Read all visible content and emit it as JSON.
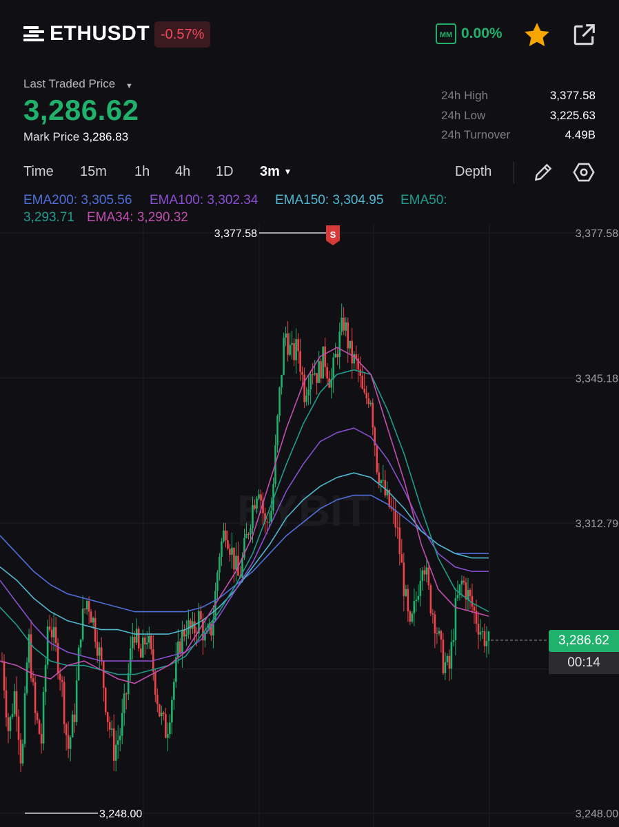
{
  "header": {
    "pair": "ETHUSDT",
    "change": "-0.57%",
    "mm_label": "MM",
    "mm_value": "0.00%"
  },
  "price_block": {
    "last_traded_label": "Last Traded Price",
    "last_price": "3,286.62",
    "mark_label": "Mark Price",
    "mark_price": "3,286.83"
  },
  "stats": [
    {
      "label": "24h High",
      "value": "3,377.58"
    },
    {
      "label": "24h Low",
      "value": "3,225.63"
    },
    {
      "label": "24h Turnover",
      "value": "4.49B"
    }
  ],
  "tabs": {
    "time": "Time",
    "m15": "15m",
    "h1": "1h",
    "h4": "4h",
    "d1": "1D",
    "m3": "3m",
    "depth": "Depth"
  },
  "ema_legend": {
    "ema200": "EMA200: 3,305.56",
    "ema100": "EMA100: 3,302.34",
    "ema150": "EMA150: 3,304.95",
    "ema50_label": "EMA50:",
    "ema50_value": "3,293.71",
    "ema34": "EMA34: 3,290.32"
  },
  "colors": {
    "up": "#20b26c",
    "down": "#ef454a",
    "ema200": "#4f6fd8",
    "ema100": "#8a4fd0",
    "ema150": "#4fb6cf",
    "ema50": "#1f9c8c",
    "ema34": "#c24fb0"
  },
  "chart_data": {
    "type": "candlestick",
    "y_ticks": [
      "3,377.58",
      "3,345.18",
      "3,312.79",
      "3,248.00"
    ],
    "ylim": [
      3248.0,
      3377.58
    ],
    "high_marker": "3,377.58",
    "low_marker": "3,248.00",
    "high_value": 3377.58,
    "low_value": 3248.0,
    "current_price": "3,286.62",
    "current_value": 3286.62,
    "countdown": "00:14",
    "signal_label": "S",
    "watermark": "BYBIT",
    "close_path": [
      3282,
      3266,
      3276,
      3258,
      3288,
      3270,
      3264,
      3292,
      3286,
      3278,
      3262,
      3270,
      3290,
      3296,
      3290,
      3282,
      3270,
      3262,
      3266,
      3276,
      3290,
      3282,
      3288,
      3280,
      3270,
      3266,
      3276,
      3286,
      3290,
      3288,
      3292,
      3286,
      3290,
      3306,
      3312,
      3306,
      3300,
      3308,
      3316,
      3322,
      3312,
      3316,
      3338,
      3356,
      3350,
      3352,
      3342,
      3348,
      3346,
      3350,
      3344,
      3352,
      3358,
      3350,
      3348,
      3340,
      3342,
      3326,
      3320,
      3316,
      3312,
      3300,
      3288,
      3296,
      3306,
      3296,
      3290,
      3282,
      3280,
      3294,
      3300,
      3296,
      3292,
      3288,
      3286
    ],
    "ema_series": {
      "ema34": [
        3282,
        3281,
        3279,
        3278,
        3281,
        3282,
        3280,
        3278,
        3277,
        3279,
        3281,
        3284,
        3290,
        3296,
        3302,
        3310,
        3322,
        3334,
        3344,
        3350,
        3352,
        3350,
        3346,
        3334,
        3322,
        3308,
        3298,
        3294,
        3293,
        3292
      ],
      "ema50": [
        3294,
        3290,
        3285,
        3282,
        3281,
        3281,
        3280,
        3279,
        3279,
        3280,
        3281,
        3283,
        3288,
        3293,
        3299,
        3306,
        3316,
        3326,
        3335,
        3342,
        3346,
        3347,
        3346,
        3338,
        3328,
        3316,
        3305,
        3298,
        3295,
        3293
      ],
      "ema100": [
        3300,
        3295,
        3290,
        3286,
        3284,
        3283,
        3282,
        3282,
        3282,
        3282,
        3283,
        3284,
        3287,
        3292,
        3298,
        3304,
        3312,
        3320,
        3326,
        3331,
        3333,
        3334,
        3332,
        3327,
        3320,
        3312,
        3306,
        3303,
        3302,
        3302
      ],
      "ema150": [
        3303,
        3300,
        3296,
        3293,
        3291,
        3290,
        3289,
        3289,
        3288,
        3288,
        3288,
        3289,
        3291,
        3294,
        3298,
        3303,
        3308,
        3314,
        3318,
        3321,
        3323,
        3324,
        3323,
        3320,
        3316,
        3311,
        3308,
        3306,
        3305,
        3305
      ],
      "ema200": [
        3310,
        3306,
        3302,
        3299,
        3297,
        3296,
        3295,
        3294,
        3293,
        3293,
        3293,
        3293,
        3294,
        3296,
        3299,
        3302,
        3306,
        3310,
        3313,
        3316,
        3318,
        3319,
        3319,
        3317,
        3314,
        3311,
        3308,
        3306,
        3306,
        3306
      ]
    }
  }
}
